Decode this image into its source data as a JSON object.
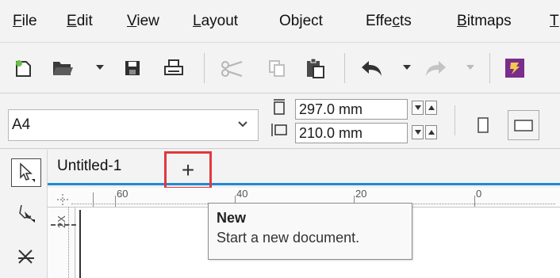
{
  "menu": {
    "items": [
      {
        "pre": "",
        "ul": "F",
        "post": "ile"
      },
      {
        "pre": "",
        "ul": "E",
        "post": "dit"
      },
      {
        "pre": "",
        "ul": "V",
        "post": "iew"
      },
      {
        "pre": "",
        "ul": "L",
        "post": "ayout"
      },
      {
        "pre": "Ob",
        "ul": "j",
        "post": "ect"
      },
      {
        "pre": "Effe",
        "ul": "c",
        "post": "ts"
      },
      {
        "pre": "",
        "ul": "B",
        "post": "itmaps"
      },
      {
        "pre": "",
        "ul": "T",
        "post": ""
      }
    ]
  },
  "toolbar": {
    "icons": [
      "new-document-icon",
      "open-folder-icon",
      "save-icon",
      "print-icon",
      "cut-icon",
      "copy-icon",
      "paste-icon",
      "undo-icon",
      "redo-icon",
      "app-launcher-icon"
    ],
    "accent": "#7a2d8c"
  },
  "propbar": {
    "page_size": "A4",
    "width_value": "297.0 mm",
    "height_value": "210.0 mm"
  },
  "tabs": {
    "document_tab": "Untitled-1",
    "new_tab_glyph": "+",
    "active_underline_color": "#1e8bd8",
    "highlight_color": "#e0393e"
  },
  "ruler": {
    "h_labels": [
      "60",
      "40",
      "20",
      "0"
    ],
    "v_label": "2X"
  },
  "tooltip": {
    "title": "New",
    "description": "Start a new document."
  }
}
